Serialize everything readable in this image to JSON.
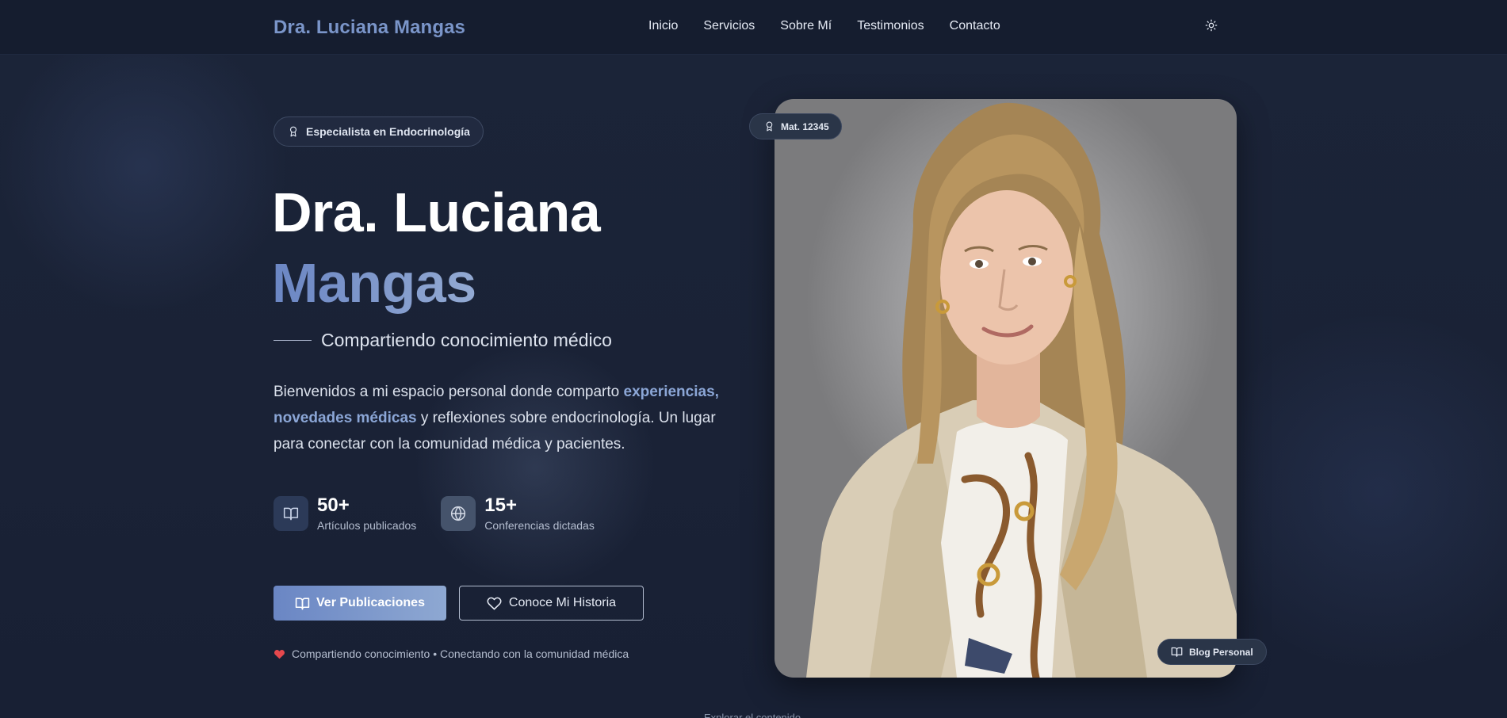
{
  "navbar": {
    "brand": "Dra. Luciana Mangas",
    "links": [
      "Inicio",
      "Servicios",
      "Sobre Mí",
      "Testimonios",
      "Contacto"
    ],
    "theme_toggle_icon": "sun-icon"
  },
  "hero": {
    "badge": "Especialista en Endocrinología",
    "badge_icon": "award-icon",
    "title_line1": "Dra. Luciana",
    "title_line2": "Mangas",
    "subtitle": "Compartiendo conocimiento médico",
    "intro": {
      "part1": "Bienvenidos a mi espacio personal donde comparto ",
      "highlight": "experiencias, novedades médicas",
      "part2": " y reflexiones sobre endocrinología. Un lugar para conectar con la comunidad médica y pacientes."
    },
    "stats": [
      {
        "value": "50+",
        "label": "Artículos publicados",
        "icon": "book-icon"
      },
      {
        "value": "15+",
        "label": "Conferencias dictadas",
        "icon": "globe-icon"
      }
    ],
    "primary_button": "Ver Publicaciones",
    "secondary_button": "Conoce Mi Historia",
    "footer_note": "Compartiendo conocimiento • Conectando con la comunidad médica",
    "explore_text": "Explorar el contenido"
  },
  "portrait": {
    "mat_badge": "Mat. 12345",
    "blog_badge": "Blog Personal"
  },
  "colors": {
    "background": "#1a2236",
    "navbar": "#151d2f",
    "accent": "#7a95c9",
    "heart": "#e5484d"
  }
}
